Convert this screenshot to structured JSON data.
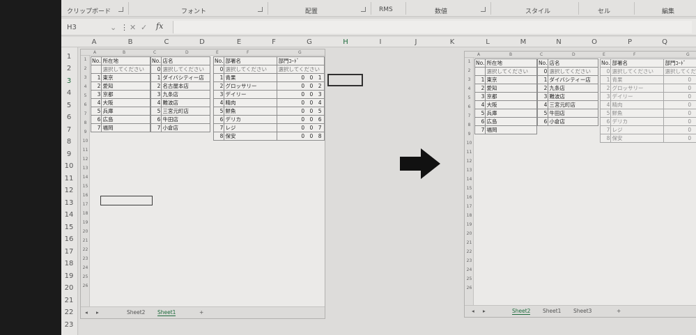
{
  "ribbon": {
    "groups": [
      {
        "label": "クリップボード",
        "launcher": true
      },
      {
        "label": "フォント",
        "launcher": true
      },
      {
        "label": "配置",
        "launcher": true
      },
      {
        "label": "RMS",
        "launcher": false
      },
      {
        "label": "数値",
        "launcher": true
      },
      {
        "label": "スタイル",
        "launcher": false
      },
      {
        "label": "セル",
        "launcher": false
      },
      {
        "label": "編集",
        "launcher": false
      }
    ]
  },
  "formula_bar": {
    "name_box": "H3",
    "fx": "fx",
    "value": ""
  },
  "main_columns": [
    "A",
    "B",
    "C",
    "D",
    "E",
    "F",
    "G",
    "H",
    "I",
    "J",
    "K",
    "L",
    "M",
    "N",
    "O",
    "P",
    "Q"
  ],
  "selected_column": "H",
  "main_rows": [
    "1",
    "2",
    "3",
    "4",
    "5",
    "6",
    "7",
    "8",
    "9",
    "10",
    "11",
    "12",
    "13",
    "14",
    "15",
    "16",
    "17",
    "18",
    "19",
    "20",
    "21",
    "22",
    "23"
  ],
  "pic_left": {
    "columns": [
      "A",
      "B",
      "C",
      "D",
      "E",
      "F",
      "G"
    ],
    "rows": [
      "1",
      "2",
      "3",
      "4",
      "5",
      "6",
      "7",
      "8",
      "9",
      "10",
      "11",
      "12",
      "13",
      "14",
      "15",
      "16",
      "17",
      "18",
      "19",
      "20",
      "21",
      "22",
      "23",
      "24",
      "25",
      "26"
    ],
    "table_location": {
      "header": [
        "No.",
        "所在地"
      ],
      "rows": [
        [
          "",
          "選択してください"
        ],
        [
          "1",
          "東京"
        ],
        [
          "2",
          "愛知"
        ],
        [
          "3",
          "京都"
        ],
        [
          "4",
          "大阪"
        ],
        [
          "5",
          "兵庫"
        ],
        [
          "6",
          "広島"
        ],
        [
          "7",
          "福岡"
        ]
      ]
    },
    "table_store": {
      "header": [
        "No.",
        "店名"
      ],
      "rows": [
        [
          "0",
          "選択してください"
        ],
        [
          "1",
          "ダイバシティー店"
        ],
        [
          "2",
          "名古屋本店"
        ],
        [
          "3",
          "九条店"
        ],
        [
          "4",
          "難波店"
        ],
        [
          "5",
          "三宮元町店"
        ],
        [
          "6",
          "牛田店"
        ],
        [
          "7",
          "小倉店"
        ]
      ]
    },
    "table_dept": {
      "header": [
        "No.",
        "部署名",
        "部門ｺｰﾄﾞ"
      ],
      "rows": [
        [
          "0",
          "選択してください",
          "選択してください"
        ],
        [
          "1",
          "青果",
          "0 0 1"
        ],
        [
          "2",
          "グロッサリー",
          "0 0 2"
        ],
        [
          "3",
          "デイリー",
          "0 0 3"
        ],
        [
          "4",
          "精肉",
          "0 0 4"
        ],
        [
          "5",
          "鮮魚",
          "0 0 5"
        ],
        [
          "6",
          "デリカ",
          "0 0 6"
        ],
        [
          "7",
          "レジ",
          "0 0 7"
        ],
        [
          "8",
          "保安",
          "0 0 8"
        ]
      ]
    },
    "tabs": [
      "Sheet2",
      "Sheet1",
      "+"
    ],
    "active_tab": "Sheet1"
  },
  "pic_right": {
    "columns": [
      "A",
      "B",
      "C",
      "D",
      "E",
      "F",
      "G"
    ],
    "rows": [
      "1",
      "2",
      "3",
      "4",
      "5",
      "6",
      "7",
      "8",
      "9",
      "10",
      "11",
      "12",
      "13",
      "14",
      "15",
      "16",
      "17",
      "18",
      "19",
      "20",
      "21",
      "22",
      "23",
      "24",
      "25",
      "26"
    ],
    "table_location": {
      "header": [
        "No.",
        "所在地"
      ],
      "rows": [
        [
          "",
          "選択してください"
        ],
        [
          "1",
          "東京"
        ],
        [
          "2",
          "愛知"
        ],
        [
          "3",
          "京都"
        ],
        [
          "4",
          "大阪"
        ],
        [
          "5",
          "兵庫"
        ],
        [
          "6",
          "広島"
        ],
        [
          "7",
          "福岡"
        ]
      ]
    },
    "table_store": {
      "header": [
        "No.",
        "店名"
      ],
      "rows": [
        [
          "0",
          "選択してください"
        ],
        [
          "1",
          "ダイバシティー店"
        ],
        [
          "2",
          "九条店"
        ],
        [
          "3",
          "難波店"
        ],
        [
          "4",
          "三宮元町店"
        ],
        [
          "5",
          "牛田店"
        ],
        [
          "6",
          "小倉店"
        ]
      ]
    },
    "table_dept": {
      "header": [
        "No.",
        "部署名",
        "部門ｺｰﾄﾞ"
      ],
      "rows": [
        [
          "0",
          "選択してください",
          "選択してください"
        ],
        [
          "1",
          "青果",
          "0 0 1"
        ],
        [
          "2",
          "グロッサリー",
          "0 0 2"
        ],
        [
          "3",
          "デイリー",
          "0 0 3"
        ],
        [
          "4",
          "精肉",
          "0 0 4"
        ],
        [
          "5",
          "鮮魚",
          "0 0 5"
        ],
        [
          "6",
          "デリカ",
          "0 0 6"
        ],
        [
          "7",
          "レジ",
          "0 0 7"
        ],
        [
          "8",
          "保安",
          "0 0 8"
        ]
      ]
    },
    "tabs": [
      "Sheet2",
      "Sheet1",
      "Sheet3",
      "+"
    ],
    "active_tab": "Sheet2"
  },
  "arrow_icon": "right-arrow-icon"
}
